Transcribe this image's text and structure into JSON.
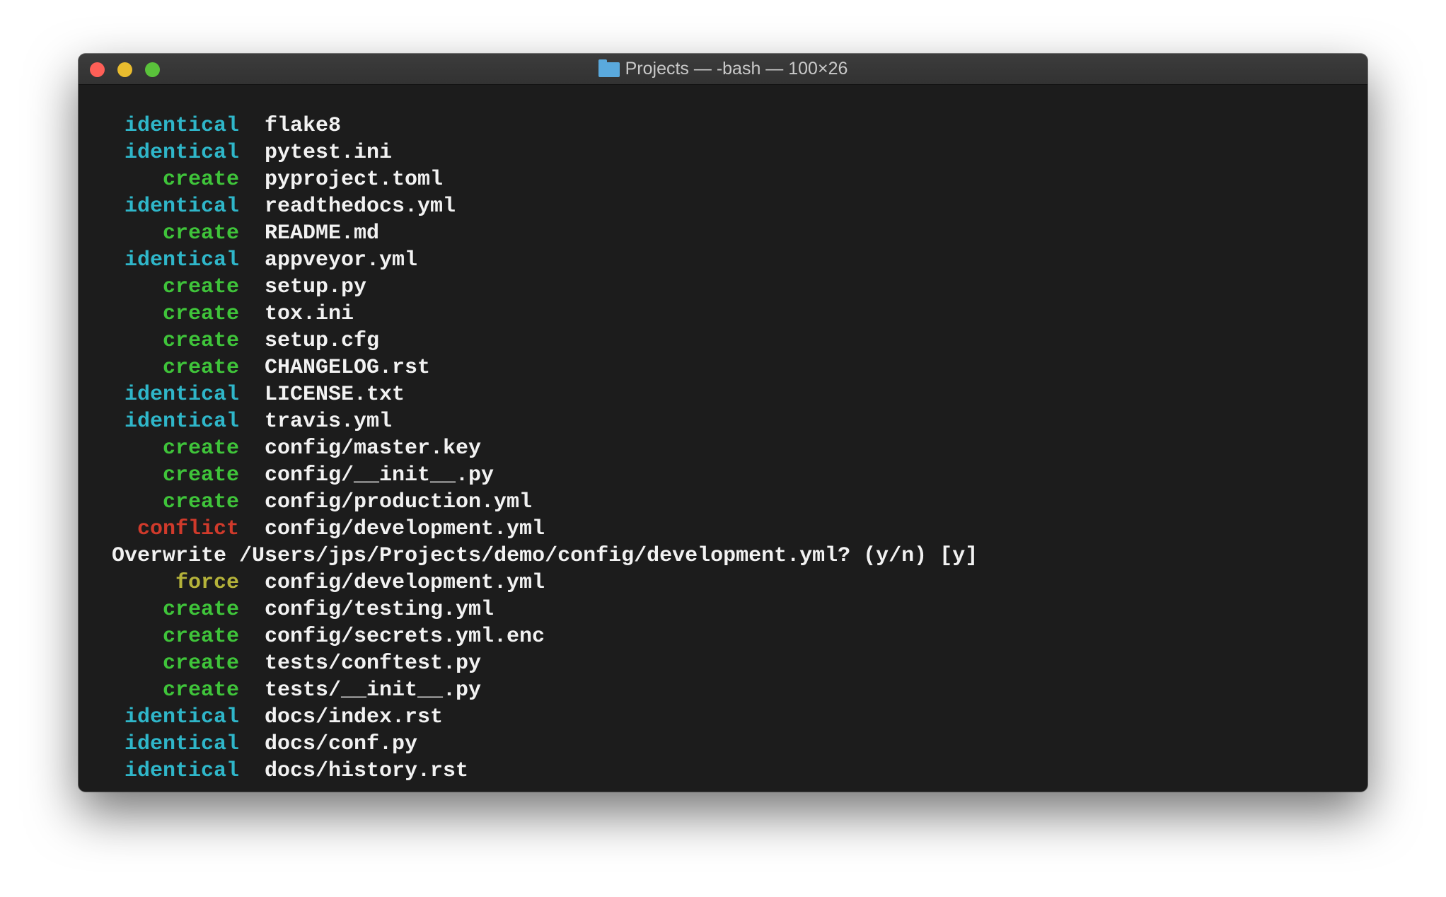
{
  "window": {
    "title": "Projects — -bash — 100×26",
    "title_icon": "folder-icon"
  },
  "colors": {
    "identical": "#2fb6c9",
    "create": "#3fc43a",
    "conflict": "#d03a2b",
    "force": "#b5b33a",
    "text": "#f2f2f2",
    "background": "#1c1c1c"
  },
  "terminal": {
    "lines": [
      {
        "status": "identical",
        "path": "flake8"
      },
      {
        "status": "identical",
        "path": "pytest.ini"
      },
      {
        "status": "create",
        "path": "pyproject.toml"
      },
      {
        "status": "identical",
        "path": "readthedocs.yml"
      },
      {
        "status": "create",
        "path": "README.md"
      },
      {
        "status": "identical",
        "path": "appveyor.yml"
      },
      {
        "status": "create",
        "path": "setup.py"
      },
      {
        "status": "create",
        "path": "tox.ini"
      },
      {
        "status": "create",
        "path": "setup.cfg"
      },
      {
        "status": "create",
        "path": "CHANGELOG.rst"
      },
      {
        "status": "identical",
        "path": "LICENSE.txt"
      },
      {
        "status": "identical",
        "path": "travis.yml"
      },
      {
        "status": "create",
        "path": "config/master.key"
      },
      {
        "status": "create",
        "path": "config/__init__.py"
      },
      {
        "status": "create",
        "path": "config/production.yml"
      },
      {
        "status": "conflict",
        "path": "config/development.yml"
      },
      {
        "prompt": "Overwrite /Users/jps/Projects/demo/config/development.yml? (y/n) [y]"
      },
      {
        "status": "force",
        "path": "config/development.yml"
      },
      {
        "status": "create",
        "path": "config/testing.yml"
      },
      {
        "status": "create",
        "path": "config/secrets.yml.enc"
      },
      {
        "status": "create",
        "path": "tests/conftest.py"
      },
      {
        "status": "create",
        "path": "tests/__init__.py"
      },
      {
        "status": "identical",
        "path": "docs/index.rst"
      },
      {
        "status": "identical",
        "path": "docs/conf.py"
      },
      {
        "status": "identical",
        "path": "docs/history.rst"
      }
    ]
  }
}
